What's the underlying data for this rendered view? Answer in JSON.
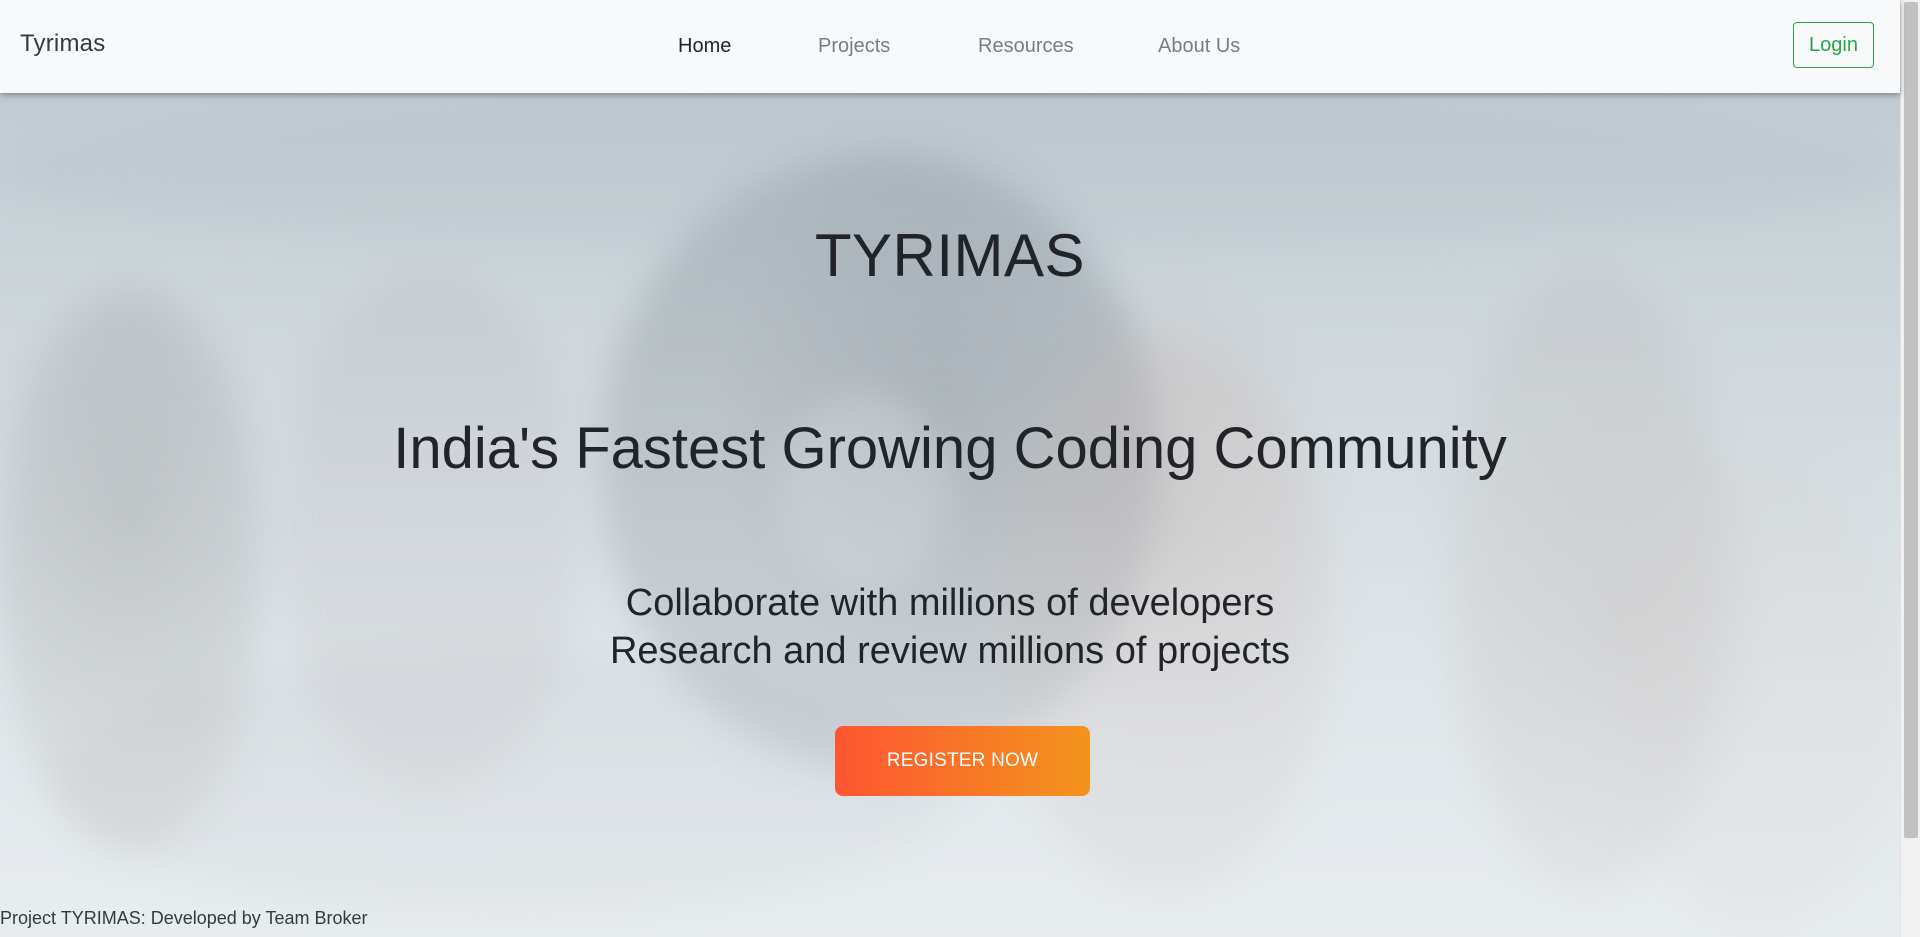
{
  "navbar": {
    "brand": "Tyrimas",
    "links": [
      {
        "label": "Home",
        "active": true
      },
      {
        "label": "Projects",
        "active": false
      },
      {
        "label": "Resources",
        "active": false
      },
      {
        "label": "About Us",
        "active": false
      }
    ],
    "login_label": "Login"
  },
  "hero": {
    "title": "TYRIMAS",
    "subtitle": "India's Fastest Growing Coding Community",
    "line1": "Collaborate with millions of developers",
    "line2": "Research and review millions of projects",
    "cta_label": "REGISTER NOW"
  },
  "footer": {
    "text": "Project TYRIMAS: Developed by Team Broker"
  },
  "colors": {
    "login_accent": "#28a745",
    "cta_gradient_start": "#ff5532",
    "cta_gradient_end": "#f3941c",
    "text_primary": "#212529",
    "nav_inactive": "#7a7d80",
    "navbar_bg": "#f8f9fa"
  }
}
